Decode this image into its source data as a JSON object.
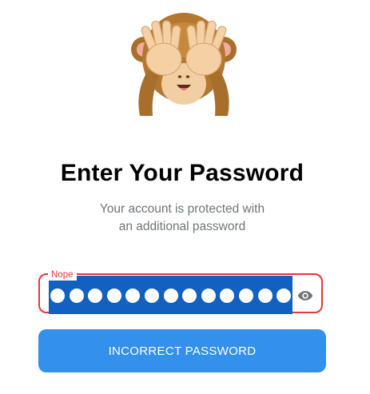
{
  "header": {
    "title": "Enter Your Password",
    "subtitle_line1": "Your account is protected with",
    "subtitle_line2": "an additional password"
  },
  "password_field": {
    "label": "Nope",
    "masked_length": 13,
    "value_selected": true,
    "state": "error",
    "toggle_icon": "eye-icon"
  },
  "submit": {
    "label": "INCORRECT PASSWORD"
  },
  "illustration": {
    "icon": "see-no-evil-monkey-icon"
  },
  "colors": {
    "accent": "#3390ec",
    "error": "#e53935",
    "selection": "#1261c1",
    "secondary_text": "#707579"
  }
}
